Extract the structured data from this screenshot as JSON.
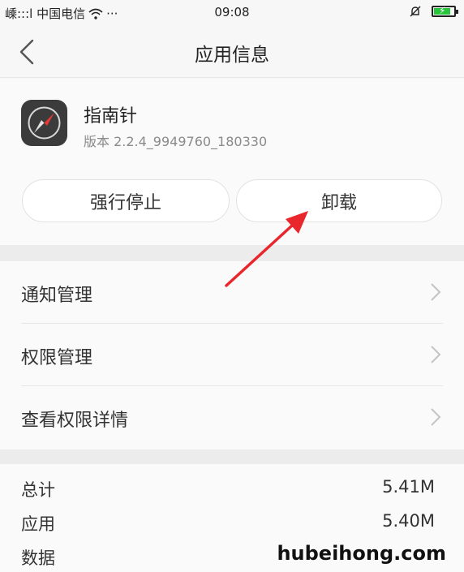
{
  "status_bar": {
    "left_text": "嵊:::l 中国电信",
    "more": "···",
    "time": "09:08",
    "battery_level": 0.85,
    "battery_color": "#27c43c"
  },
  "header": {
    "title": "应用信息",
    "back_icon": "chevron-left-icon"
  },
  "app": {
    "name": "指南针",
    "version": "版本 2.2.4_9949760_180330",
    "icon": "compass-icon"
  },
  "actions": {
    "force_stop": "强行停止",
    "uninstall": "卸载"
  },
  "menu": {
    "items": [
      {
        "label": "通知管理"
      },
      {
        "label": "权限管理"
      },
      {
        "label": "查看权限详情"
      }
    ]
  },
  "storage": {
    "rows": [
      {
        "label": "总计",
        "value": "5.41M"
      },
      {
        "label": "应用",
        "value": "5.40M"
      },
      {
        "label": "数据",
        "value": ""
      }
    ]
  },
  "watermark": "hubeihong.com",
  "annotation": {
    "arrow_color": "#e8262c"
  }
}
